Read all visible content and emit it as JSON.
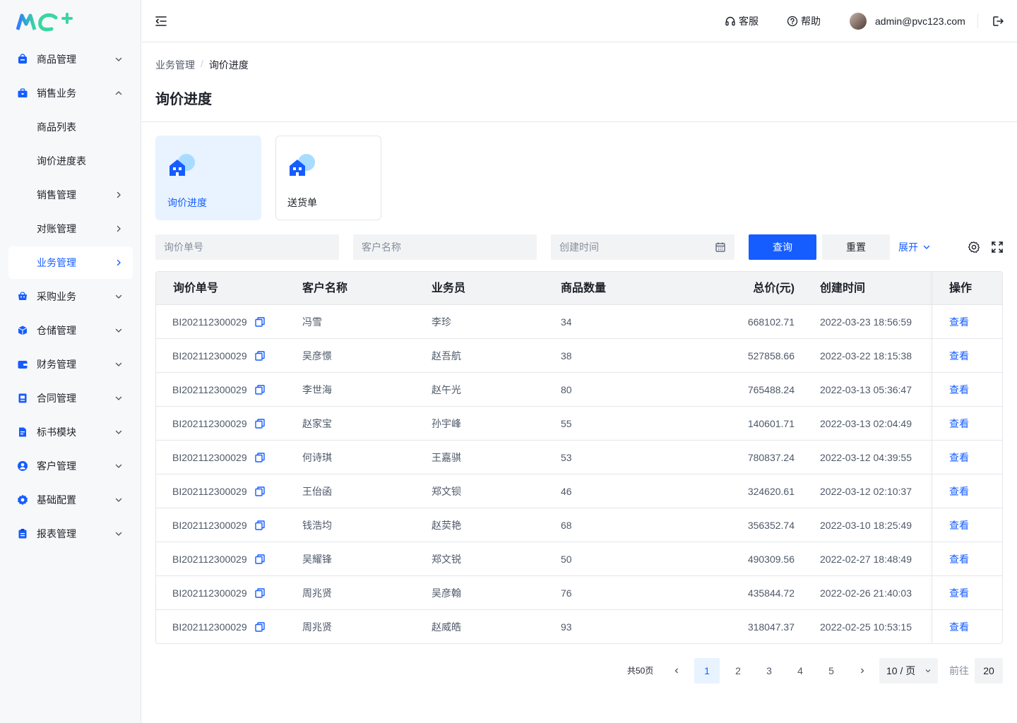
{
  "brand": {
    "primary": "#165dff",
    "logo_alt": "MC+"
  },
  "sidebar": {
    "items": [
      {
        "label": "商品管理",
        "icon": "bag-icon",
        "chevron": "down"
      },
      {
        "label": "销售业务",
        "icon": "briefcase-icon",
        "chevron": "up"
      },
      {
        "label": "商品列表",
        "icon": "",
        "chevron": ""
      },
      {
        "label": "询价进度表",
        "icon": "",
        "chevron": ""
      },
      {
        "label": "销售管理",
        "icon": "",
        "chevron": "right"
      },
      {
        "label": "对账管理",
        "icon": "",
        "chevron": "right"
      },
      {
        "label": "业务管理",
        "icon": "",
        "chevron": "right",
        "active": true
      },
      {
        "label": "采购业务",
        "icon": "cart-icon",
        "chevron": "down"
      },
      {
        "label": "仓储管理",
        "icon": "box-icon",
        "chevron": "down"
      },
      {
        "label": "财务管理",
        "icon": "wallet-icon",
        "chevron": "down"
      },
      {
        "label": "合同管理",
        "icon": "contract-icon",
        "chevron": "down"
      },
      {
        "label": "标书模块",
        "icon": "document-icon",
        "chevron": "down"
      },
      {
        "label": "客户管理",
        "icon": "user-icon",
        "chevron": "down"
      },
      {
        "label": "基础配置",
        "icon": "gear-icon",
        "chevron": "down"
      },
      {
        "label": "报表管理",
        "icon": "clipboard-icon",
        "chevron": "down"
      }
    ]
  },
  "header": {
    "service": "客服",
    "help": "帮助",
    "user_email": "admin@pvc123.com"
  },
  "breadcrumb": {
    "parent": "业务管理",
    "sep": "/",
    "current": "询价进度"
  },
  "page_title": "询价进度",
  "cards": [
    {
      "label": "询价进度",
      "selected": true
    },
    {
      "label": "送货单",
      "selected": false
    }
  ],
  "filters": {
    "order_no_placeholder": "询价单号",
    "customer_placeholder": "客户名称",
    "created_placeholder": "创建时间",
    "search_label": "查询",
    "reset_label": "重置",
    "expand_label": "展开"
  },
  "table": {
    "columns": [
      "询价单号",
      "客户名称",
      "业务员",
      "商品数量",
      "总价(元)",
      "创建时间",
      "操作"
    ],
    "rows": [
      {
        "no": "BI202112300029",
        "customer": "冯雪",
        "sales": "李珍",
        "qty": "34",
        "total": "668102.71",
        "created": "2022-03-23 18:56:59",
        "op": "查看"
      },
      {
        "no": "BI202112300029",
        "customer": "吴彦憬",
        "sales": "赵吾航",
        "qty": "38",
        "total": "527858.66",
        "created": "2022-03-22 18:15:38",
        "op": "查看"
      },
      {
        "no": "BI202112300029",
        "customer": "李世海",
        "sales": "赵午光",
        "qty": "80",
        "total": "765488.24",
        "created": "2022-03-13 05:36:47",
        "op": "查看"
      },
      {
        "no": "BI202112300029",
        "customer": "赵家宝",
        "sales": "孙宇峰",
        "qty": "55",
        "total": "140601.71",
        "created": "2022-03-13 02:04:49",
        "op": "查看"
      },
      {
        "no": "BI202112300029",
        "customer": "何诗琪",
        "sales": "王嘉骐",
        "qty": "53",
        "total": "780837.24",
        "created": "2022-03-12 04:39:55",
        "op": "查看"
      },
      {
        "no": "BI202112300029",
        "customer": "王佁函",
        "sales": "郑文钡",
        "qty": "46",
        "total": "324620.61",
        "created": "2022-03-12 02:10:37",
        "op": "查看"
      },
      {
        "no": "BI202112300029",
        "customer": "钱浩均",
        "sales": "赵荬艳",
        "qty": "68",
        "total": "356352.74",
        "created": "2022-03-10 18:25:49",
        "op": "查看"
      },
      {
        "no": "BI202112300029",
        "customer": "吴耀锋",
        "sales": "郑文锐",
        "qty": "50",
        "total": "490309.56",
        "created": "2022-02-27 18:48:49",
        "op": "查看"
      },
      {
        "no": "BI202112300029",
        "customer": "周兆贤",
        "sales": "吴彦翰",
        "qty": "76",
        "total": "435844.72",
        "created": "2022-02-26 21:40:03",
        "op": "查看"
      },
      {
        "no": "BI202112300029",
        "customer": "周兆贤",
        "sales": "赵威皓",
        "qty": "93",
        "total": "318047.37",
        "created": "2022-02-25 10:53:15",
        "op": "查看"
      }
    ]
  },
  "pagination": {
    "total_label": "共50页",
    "pages": [
      "1",
      "2",
      "3",
      "4",
      "5"
    ],
    "current": "1",
    "page_size": "10 / 页",
    "goto_label": "前往",
    "goto_value": "20"
  }
}
